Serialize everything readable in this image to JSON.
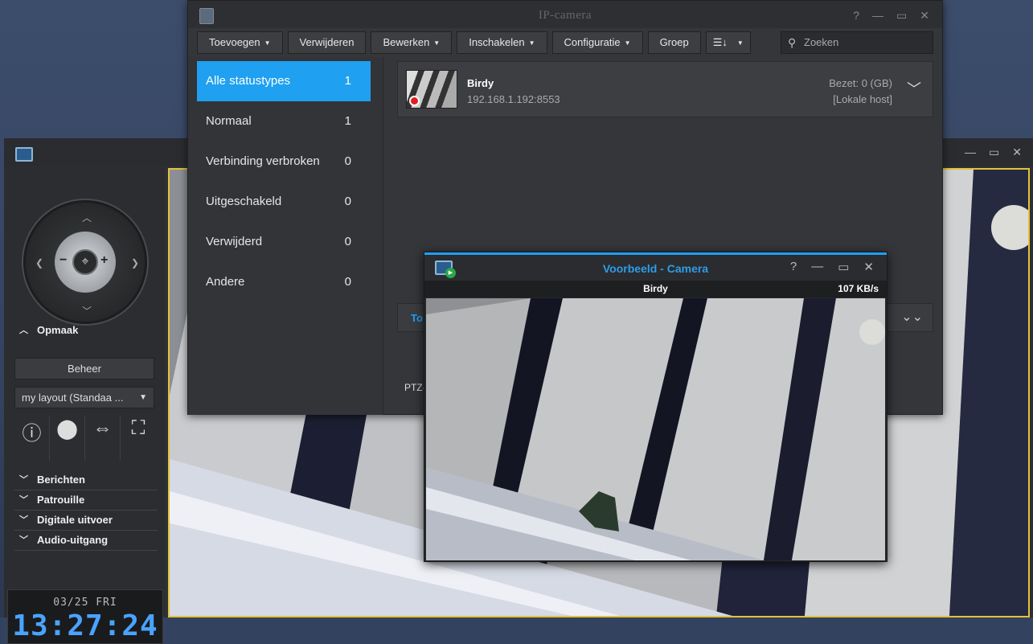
{
  "liveview": {
    "sections": {
      "layout_label": "Opmaak",
      "messages_label": "Berichten",
      "patrol_label": "Patrouille",
      "digital_output_label": "Digitale uitvoer",
      "audio_output_label": "Audio-uitgang"
    },
    "manage_label": "Beheer",
    "layout_select": "my layout (Standaa ...",
    "clock": {
      "date": "03/25  FRI",
      "time": "13:27:24"
    }
  },
  "ipcamera": {
    "title": "IP-camera",
    "toolbar": {
      "add": "Toevoegen",
      "delete": "Verwijderen",
      "edit": "Bewerken",
      "enable": "Inschakelen",
      "config": "Configuratie",
      "group": "Groep"
    },
    "search_placeholder": "Zoeken",
    "statuses": [
      {
        "label": "Alle statustypes",
        "count": "1"
      },
      {
        "label": "Normaal",
        "count": "1"
      },
      {
        "label": "Verbinding verbroken",
        "count": "0"
      },
      {
        "label": "Uitgeschakeld",
        "count": "0"
      },
      {
        "label": "Verwijderd",
        "count": "0"
      },
      {
        "label": "Andere",
        "count": "0"
      }
    ],
    "camera": {
      "name": "Birdy",
      "address": "192.168.1.192:8553",
      "used": "Bezet: 0 (GB)",
      "host": "[Lokale host]"
    },
    "bottom_tab": "To",
    "ptz_label": "PTZ-"
  },
  "preview": {
    "title": "Voorbeeld - Camera",
    "camera_name": "Birdy",
    "bitrate": "107 KB/s"
  },
  "colors": {
    "accent": "#1fa0f0",
    "highlight_border": "#e3c23a",
    "clock_digits": "#4aa3ff"
  }
}
